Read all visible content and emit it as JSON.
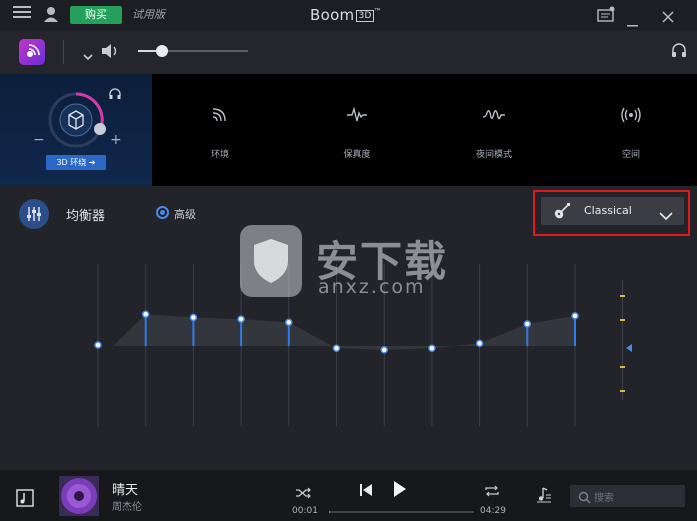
{
  "titlebar": {
    "buy_label": "购买",
    "trial_label": "试用版",
    "app_title": "Boom",
    "app_title_badge": "3D",
    "app_title_tm": "™"
  },
  "effects": {
    "surround_button": "3D 环绕 ➜",
    "items": [
      {
        "label": "环境",
        "icon": "ambience-icon"
      },
      {
        "label": "保真度",
        "icon": "fidelity-icon"
      },
      {
        "label": "夜间模式",
        "icon": "night-mode-icon"
      },
      {
        "label": "空间",
        "icon": "spatial-icon"
      }
    ]
  },
  "equalizer": {
    "title": "均衡器",
    "advanced_label": "高级",
    "preset": "Classical",
    "bands": [
      0.5,
      0.69,
      0.67,
      0.66,
      0.64,
      0.48,
      0.47,
      0.48,
      0.51,
      0.63,
      0.68
    ]
  },
  "player": {
    "song_title": "晴天",
    "artist": "周杰伦",
    "elapsed": "00:01",
    "total": "04:29",
    "progress": 0.004,
    "search_placeholder": "搜索"
  },
  "volume": {
    "level": 0.22
  },
  "watermark": {
    "text": "安下载",
    "sub": "anxz.com"
  },
  "colors": {
    "accent": "#2f7ce6",
    "buy": "#23a05a",
    "highlight": "#e0171d"
  }
}
